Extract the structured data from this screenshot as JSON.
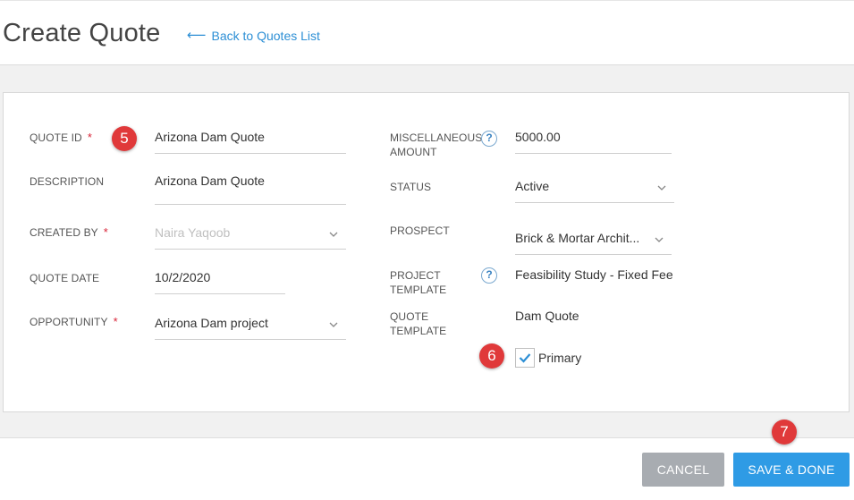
{
  "header": {
    "title": "Create Quote",
    "back_link": "Back to Quotes List"
  },
  "badges": {
    "b5": "5",
    "b6": "6",
    "b7": "7"
  },
  "form": {
    "quote_id": {
      "label": "QUOTE ID",
      "required": "*",
      "value": "Arizona Dam Quote"
    },
    "description": {
      "label": "DESCRIPTION",
      "value": "Arizona Dam Quote"
    },
    "created_by": {
      "label": "CREATED BY",
      "required": "*",
      "value": "Naira Yaqoob"
    },
    "quote_date": {
      "label": "QUOTE DATE",
      "value": "10/2/2020"
    },
    "opportunity": {
      "label": "OPPORTUNITY",
      "required": "*",
      "value": "Arizona Dam project"
    },
    "misc_amount": {
      "label_line1": "MISCELLANEOUS",
      "label_line2": "AMOUNT",
      "value": "5000.00"
    },
    "status": {
      "label": "STATUS",
      "value": "Active"
    },
    "prospect": {
      "label": "PROSPECT",
      "value": "Brick & Mortar Archit..."
    },
    "project_template": {
      "label_line1": "PROJECT",
      "label_line2": "TEMPLATE",
      "value": "Feasibility Study - Fixed Fee"
    },
    "quote_template": {
      "label_line1": "QUOTE",
      "label_line2": "TEMPLATE",
      "value": "Dam Quote"
    },
    "primary": {
      "label": "Primary",
      "checked": true
    }
  },
  "help_icon_glyph": "?",
  "buttons": {
    "cancel": "CANCEL",
    "save_done": "SAVE & DONE"
  },
  "colors": {
    "accent": "#2f9be5",
    "link": "#2d8fd5",
    "required": "#d9263a",
    "badge": "#e0393a",
    "cancel": "#a8acb1"
  }
}
